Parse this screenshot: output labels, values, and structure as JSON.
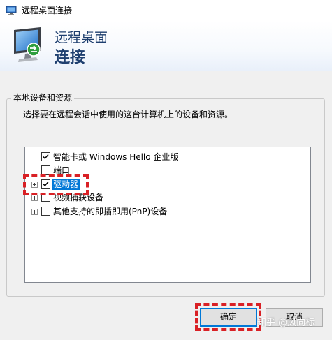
{
  "window": {
    "title": "远程桌面连接",
    "app_icon": "remote-desktop-icon"
  },
  "banner": {
    "line1": "远程桌面",
    "line2": "连接",
    "icon": "monitor-connection-icon"
  },
  "group": {
    "legend": "本地设备和资源",
    "description": "选择要在远程会话中使用的这台计算机上的设备和资源。"
  },
  "tree": {
    "items": [
      {
        "label": "智能卡或 Windows Hello 企业版",
        "checked": true,
        "expandable": false,
        "selected": false
      },
      {
        "label": "端口",
        "checked": false,
        "expandable": false,
        "selected": false
      },
      {
        "label": "驱动器",
        "checked": true,
        "expandable": true,
        "selected": true
      },
      {
        "label": "视频捕获设备",
        "checked": false,
        "expandable": true,
        "selected": false
      },
      {
        "label": "其他支持的即插即用(PnP)设备",
        "checked": false,
        "expandable": true,
        "selected": false
      }
    ]
  },
  "buttons": {
    "ok": "确定",
    "cancel": "取消"
  },
  "watermark": "知乎 @风向标",
  "colors": {
    "selection": "#0078d7",
    "banner_text": "#1e3f6f",
    "annotation": "#d92025"
  }
}
